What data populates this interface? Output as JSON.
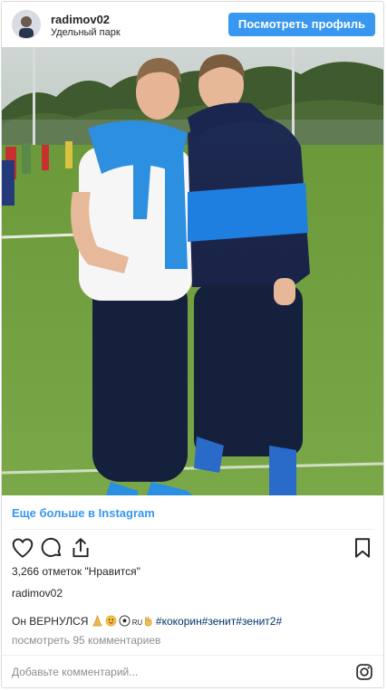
{
  "header": {
    "username": "radimov02",
    "location": "Удельный парк",
    "profile_button": "Посмотреть профиль"
  },
  "photo": {
    "icon": "instagram-photo"
  },
  "more_link": "Еще больше в Instagram",
  "actions": {
    "like_icon": "heart-icon",
    "comment_icon": "comment-icon",
    "share_icon": "share-icon",
    "save_icon": "bookmark-icon"
  },
  "likes": "3,266 отметок \"Нравится\"",
  "caption": {
    "username": "radimov02",
    "text": "Он ВЕРНУЛСЯ",
    "ru_label": "RU",
    "hashtags": "#кокорин#зенит#зенит2#"
  },
  "comments_link": "посмотреть 95 комментариев",
  "comment_input": {
    "placeholder": "Добавьте комментарий..."
  },
  "colors": {
    "accent": "#3897f0",
    "text": "#262626",
    "muted": "#8e8e8e",
    "hashtag": "#003569"
  }
}
